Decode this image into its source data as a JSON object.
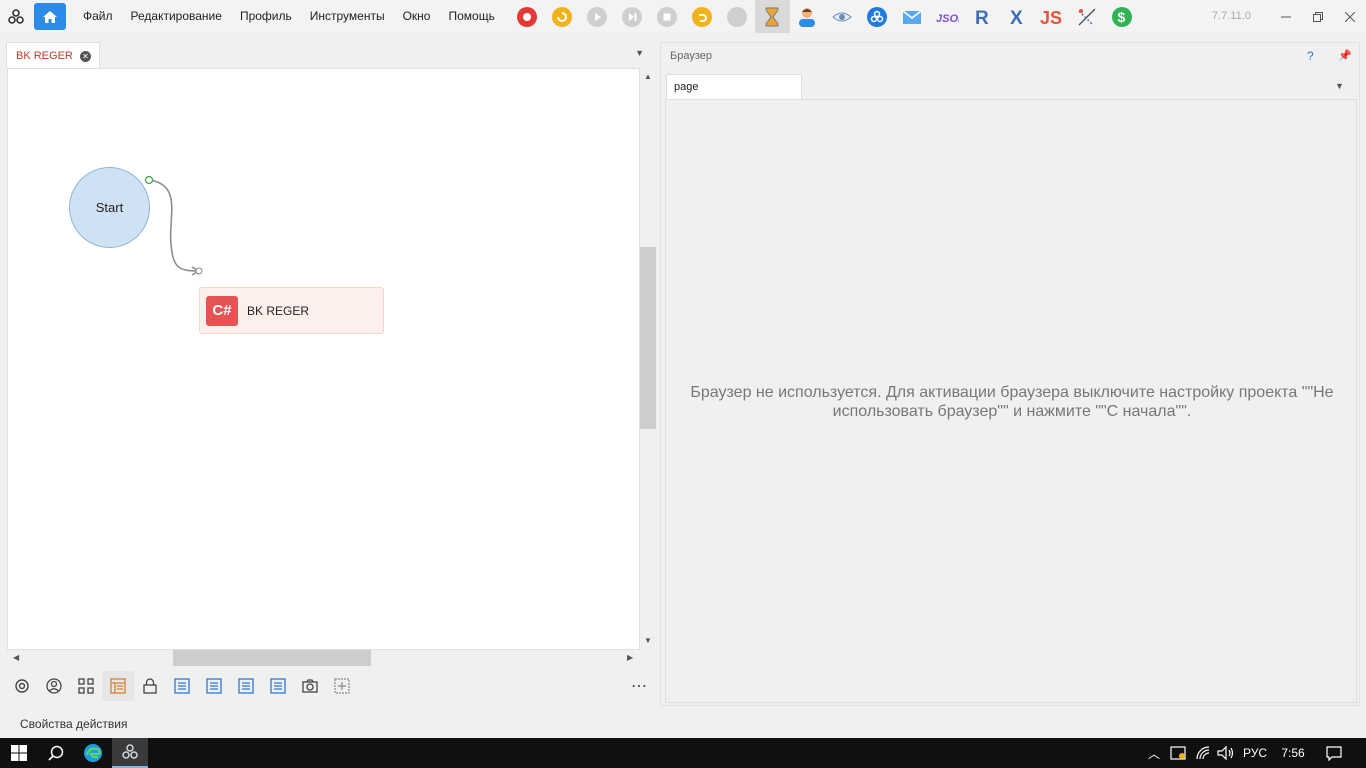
{
  "app": {
    "version": "7.7.11.0",
    "menu": [
      "Файл",
      "Редактирование",
      "Профиль",
      "Инструменты",
      "Окно",
      "Помощь"
    ],
    "toolbar_icons": [
      "record-icon",
      "refresh-icon",
      "play-icon",
      "step-icon",
      "stop-icon",
      "undo-icon",
      "disabled-icon",
      "hourglass-icon",
      "user-icon",
      "eye-icon",
      "zennoposter-icon",
      "mail-icon",
      "json-icon",
      "regex-icon",
      "xpath-icon",
      "js-icon",
      "paint-icon",
      "dollar-icon"
    ]
  },
  "left_panel": {
    "tab_label": "BK REGER",
    "nodes": {
      "start_label": "Start",
      "action_badge": "C#",
      "action_label": "BK REGER"
    },
    "bottom_toolbar_icons": [
      "gear-icon",
      "user-circle-icon",
      "grid-icon",
      "layout-icon",
      "lock-icon",
      "list-icon",
      "list-icon",
      "list-icon",
      "list-icon",
      "camera-icon",
      "add-icon"
    ]
  },
  "right_panel": {
    "title": "Браузер",
    "help": "?",
    "tab_label": "page",
    "message": "Браузер не используется. Для активации браузера выключите настройку проекта \"\"Не использовать браузер\"\" и нажмите \"\"С начала\"\"."
  },
  "status_bar": {
    "text": "Свойства действия"
  },
  "taskbar": {
    "lang": "РУС",
    "time": "7:56"
  }
}
